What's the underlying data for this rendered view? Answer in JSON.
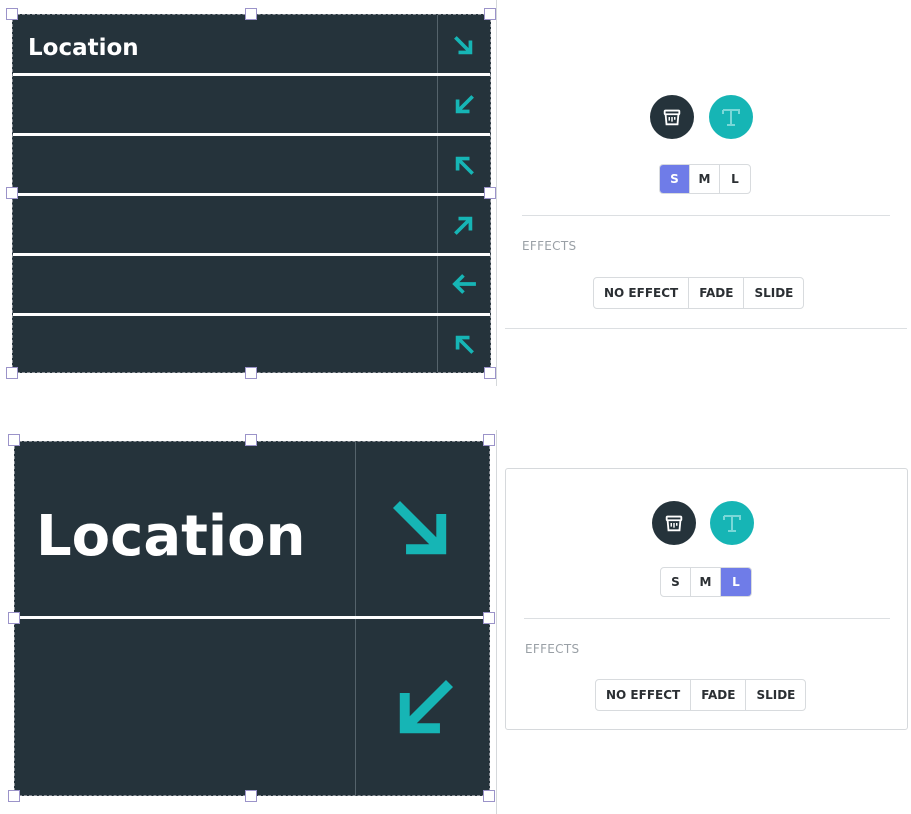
{
  "colors": {
    "sign_background": "#25333b",
    "arrow_accent": "#16b5b5",
    "size_active": "#6f7ce8",
    "text_button_bg": "#16b5b5",
    "style_button_bg": "#25333b"
  },
  "sign_small": {
    "title": "Location",
    "arrows": [
      "arrow-down-right-icon",
      "arrow-down-left-icon",
      "arrow-up-left-icon",
      "arrow-up-right-icon",
      "arrow-left-icon",
      "arrow-up-left-icon"
    ]
  },
  "sign_large": {
    "title": "Location",
    "arrows": [
      "arrow-down-right-icon",
      "arrow-down-left-icon"
    ]
  },
  "panel_top": {
    "style_button_icon": "paint-bucket-icon",
    "text_button_icon": "text-t-icon",
    "sizes": [
      "S",
      "M",
      "L"
    ],
    "active_size": "S",
    "effects_label": "EFFECTS",
    "effects": [
      "NO EFFECT",
      "FADE",
      "SLIDE"
    ]
  },
  "panel_bottom": {
    "style_button_icon": "paint-bucket-icon",
    "text_button_icon": "text-t-icon",
    "sizes": [
      "S",
      "M",
      "L"
    ],
    "active_size": "L",
    "effects_label": "EFFECTS",
    "effects": [
      "NO EFFECT",
      "FADE",
      "SLIDE"
    ]
  }
}
